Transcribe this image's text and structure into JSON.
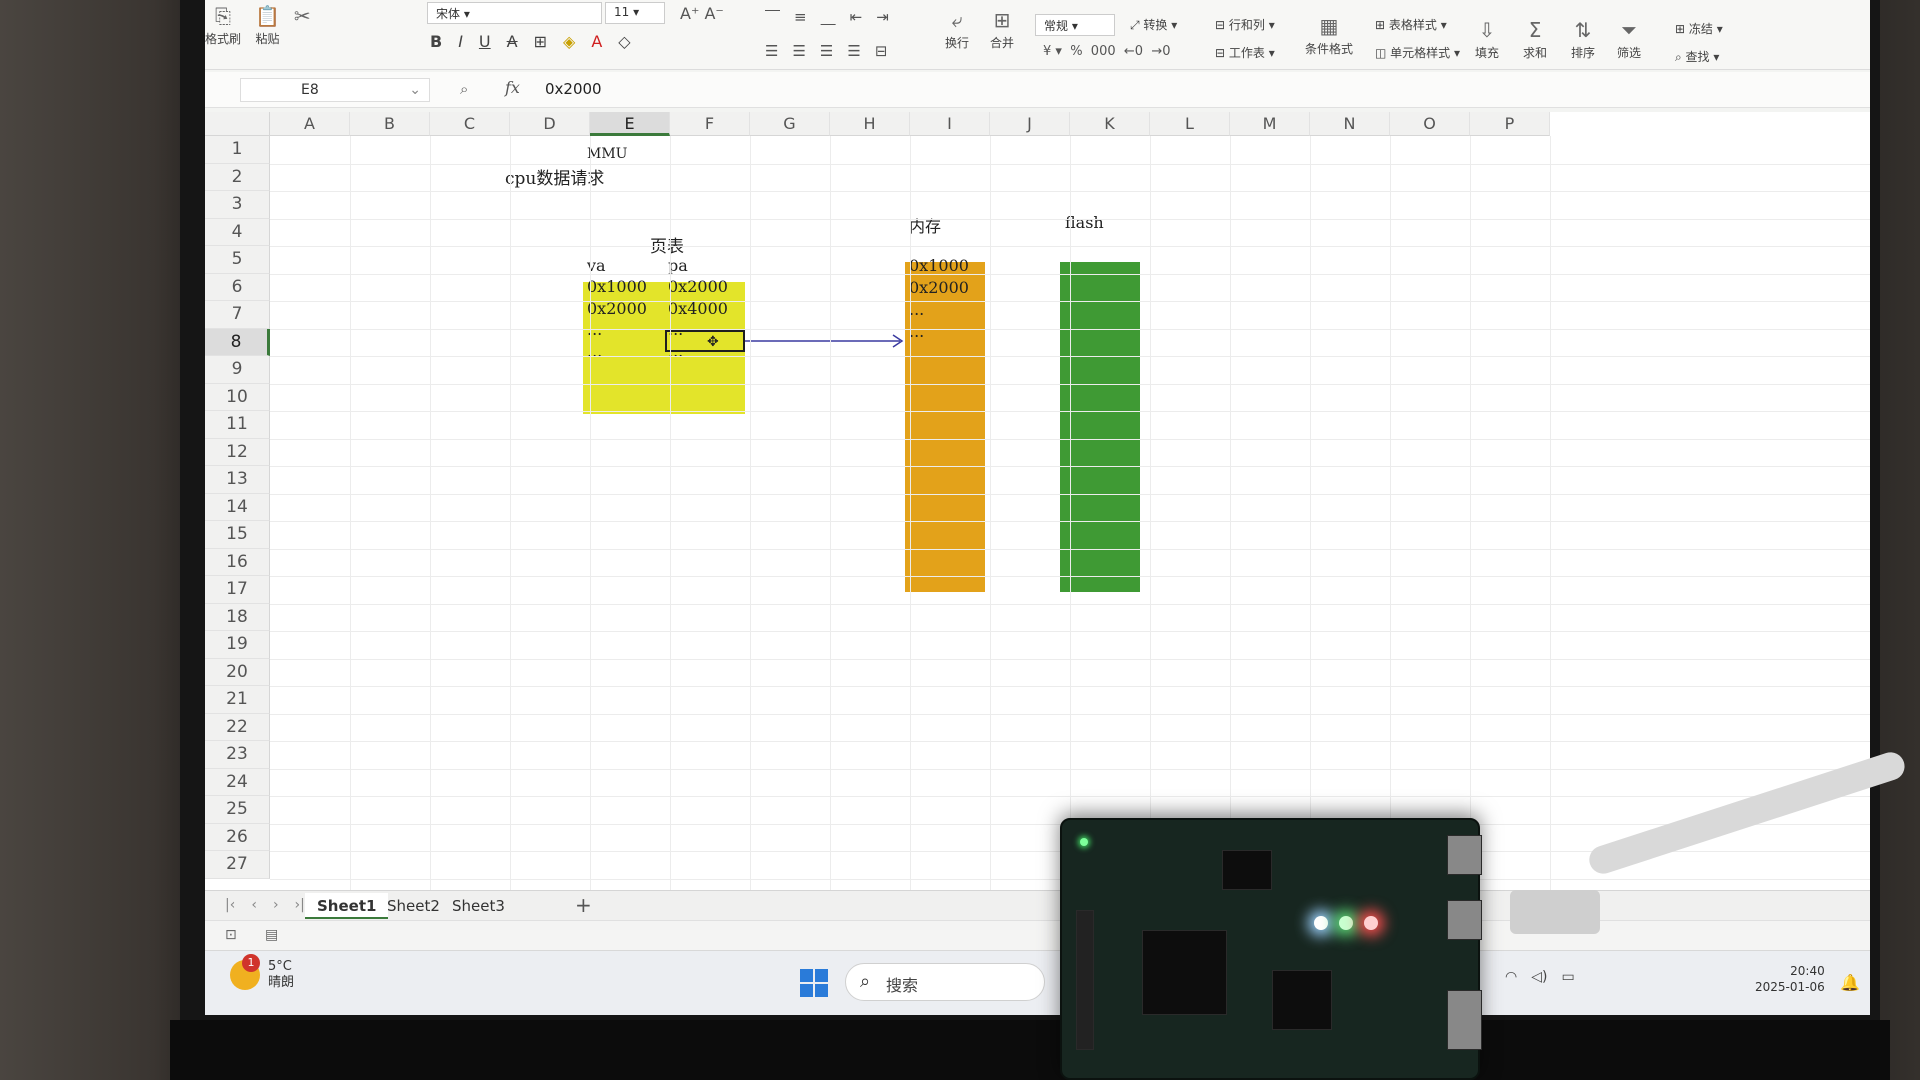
{
  "ribbon": {
    "format_painter": "格式刷",
    "paste": "粘贴",
    "font_name": "宋体",
    "font_size": "11",
    "wrap": "换行",
    "merge": "合并",
    "number_format": "常规",
    "convert": "转换",
    "rows_cols": "行和列",
    "worksheet": "工作表",
    "cond_format": "条件格式",
    "table_style": "表格样式",
    "cell_style": "单元格样式",
    "fill": "填充",
    "sum": "求和",
    "sort": "排序",
    "filter": "筛选",
    "freeze": "冻结",
    "find": "查找"
  },
  "formula_bar": {
    "name_box": "E8",
    "fx": "fx",
    "value": "0x2000"
  },
  "columns": [
    "A",
    "B",
    "C",
    "D",
    "E",
    "F",
    "G",
    "H",
    "I",
    "J",
    "K",
    "L",
    "M",
    "N",
    "O",
    "P"
  ],
  "rows": [
    "1",
    "2",
    "3",
    "4",
    "5",
    "6",
    "7",
    "8",
    "9",
    "10",
    "11",
    "12",
    "13",
    "14",
    "15",
    "16",
    "17",
    "18",
    "19",
    "20",
    "21",
    "22",
    "23",
    "24",
    "25",
    "26",
    "27"
  ],
  "active_cell": {
    "column": "E",
    "row": "8"
  },
  "cells": {
    "mmu": "MMU",
    "cpu_request": "cpu数据请求",
    "page_table_title": "页表",
    "va_header": "va",
    "pa_header": "pa",
    "va1": "0x1000",
    "pa1": "0x2000",
    "va2": "0x2000",
    "pa2": "0x4000",
    "va3": "...",
    "pa3": "...",
    "va4": "...",
    "pa4": "...",
    "memory_title": "内存",
    "mem1": "0x1000",
    "mem2": "0x2000",
    "mem3": "...",
    "mem4": "...",
    "flash_title": "flash"
  },
  "colors": {
    "page_table": "#e3e42a",
    "memory": "#e3a21a",
    "flash": "#3f9a34",
    "arrow": "#3a3aa0"
  },
  "sheets": [
    "Sheet1",
    "Sheet2",
    "Sheet3"
  ],
  "active_sheet": "Sheet1",
  "taskbar": {
    "weather_badge": "1",
    "temperature": "5°C",
    "weather": "晴朗",
    "search_placeholder": "搜索",
    "time": "20:40",
    "date": "2025-01-06"
  }
}
